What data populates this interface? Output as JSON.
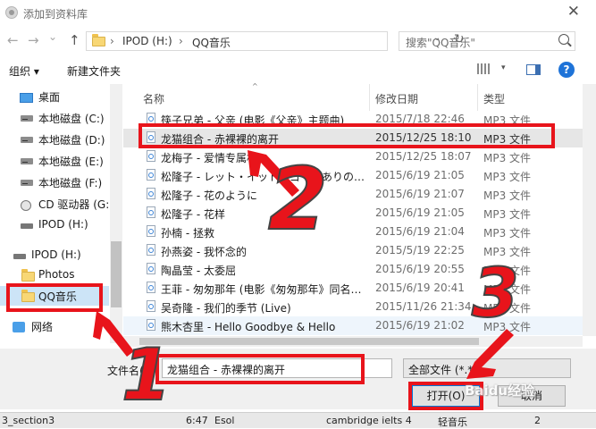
{
  "window": {
    "title": "添加到资料库",
    "close_glyph": "✕"
  },
  "nav": {
    "back": "←",
    "forward": "→",
    "recent": "⌄",
    "up": "↑"
  },
  "address": {
    "path": [
      "IPOD (H:)",
      "QQ音乐"
    ],
    "sep": "›",
    "dropdown": "⌄",
    "refresh": "↻"
  },
  "search": {
    "placeholder": "搜索\"QQ音乐\""
  },
  "toolbar": {
    "organize": "组织 ▾",
    "new_folder": "新建文件夹",
    "view_drop": "▾",
    "help": "?"
  },
  "sidebar": {
    "items": [
      {
        "label": "桌面",
        "kind": "desktop"
      },
      {
        "label": "本地磁盘 (C:)",
        "kind": "drive"
      },
      {
        "label": "本地磁盘 (D:)",
        "kind": "drive"
      },
      {
        "label": "本地磁盘 (E:)",
        "kind": "drive"
      },
      {
        "label": "本地磁盘 (F:)",
        "kind": "drive"
      },
      {
        "label": "CD 驱动器 (G:",
        "kind": "cd"
      },
      {
        "label": "IPOD (H:)",
        "kind": "ipod"
      },
      {
        "label": "IPOD (H:)",
        "kind": "ipod-root"
      },
      {
        "label": "Photos",
        "kind": "folder"
      },
      {
        "label": "QQ音乐",
        "kind": "folder-selected"
      },
      {
        "label": "网络",
        "kind": "network"
      }
    ]
  },
  "columns": {
    "name": "名称",
    "date": "修改日期",
    "type": "类型",
    "sort_arrow": "^"
  },
  "files": [
    {
      "name": "筷子兄弟 - 父亲 (电影《父亲》主题曲)",
      "date": "2015/7/18 22:46",
      "type": "MP3 文件"
    },
    {
      "name": "龙猫组合 - 赤裸裸的离开",
      "date": "2015/12/25 18:10",
      "type": "MP3 文件",
      "selected": true
    },
    {
      "name": "龙梅子 - 爱情专属权",
      "date": "2015/12/25 18:07",
      "type": "MP3 文件"
    },
    {
      "name": "松隆子 - レット・イット・ゴー～ありの…",
      "date": "2015/6/19 21:05",
      "type": "MP3 文件"
    },
    {
      "name": "松隆子 - 花のように",
      "date": "2015/6/19 21:07",
      "type": "MP3 文件"
    },
    {
      "name": "松隆子 - 花样",
      "date": "2015/6/19 21:05",
      "type": "MP3 文件"
    },
    {
      "name": "孙楠 - 拯救",
      "date": "2015/6/19 21:04",
      "type": "MP3 文件"
    },
    {
      "name": "孙燕姿 - 我怀念的",
      "date": "2015/5/19 22:25",
      "type": "MP3 文件"
    },
    {
      "name": "陶晶莹 - 太委屈",
      "date": "2015/6/19 20:55",
      "type": "MP3 文件"
    },
    {
      "name": "王菲 - 匆匆那年 (电影《匆匆那年》同名…",
      "date": "2015/6/19 20:41",
      "type": "MP3 文件"
    },
    {
      "name": "吴奇隆 - 我们的季节 (Live)",
      "date": "2015/11/26 21:34",
      "type": "MP3 文件"
    },
    {
      "name": "熊木杏里 - Hello Goodbye & Hello",
      "date": "2015/6/19 21:02",
      "type": "MP3 文件"
    }
  ],
  "footer": {
    "filename_label": "文件名(N):",
    "filename_value": "龙猫组合 - 赤裸裸的离开",
    "filetype_value": "全部文件 (*.*)",
    "dropdown": "⌄",
    "open": "打开(O)",
    "cancel": "取消"
  },
  "status_row": [
    "3_section3",
    "6:47",
    "Esol",
    "cambridge ielts 4",
    "轻音乐",
    "2"
  ],
  "annotations": {
    "n1": "1",
    "n2": "2",
    "n3": "3",
    "watermark": "Baidu经验"
  },
  "colors": {
    "annotation_red": "#e8141b",
    "selection": "#e6e6e6",
    "accent": "#0078d7"
  }
}
